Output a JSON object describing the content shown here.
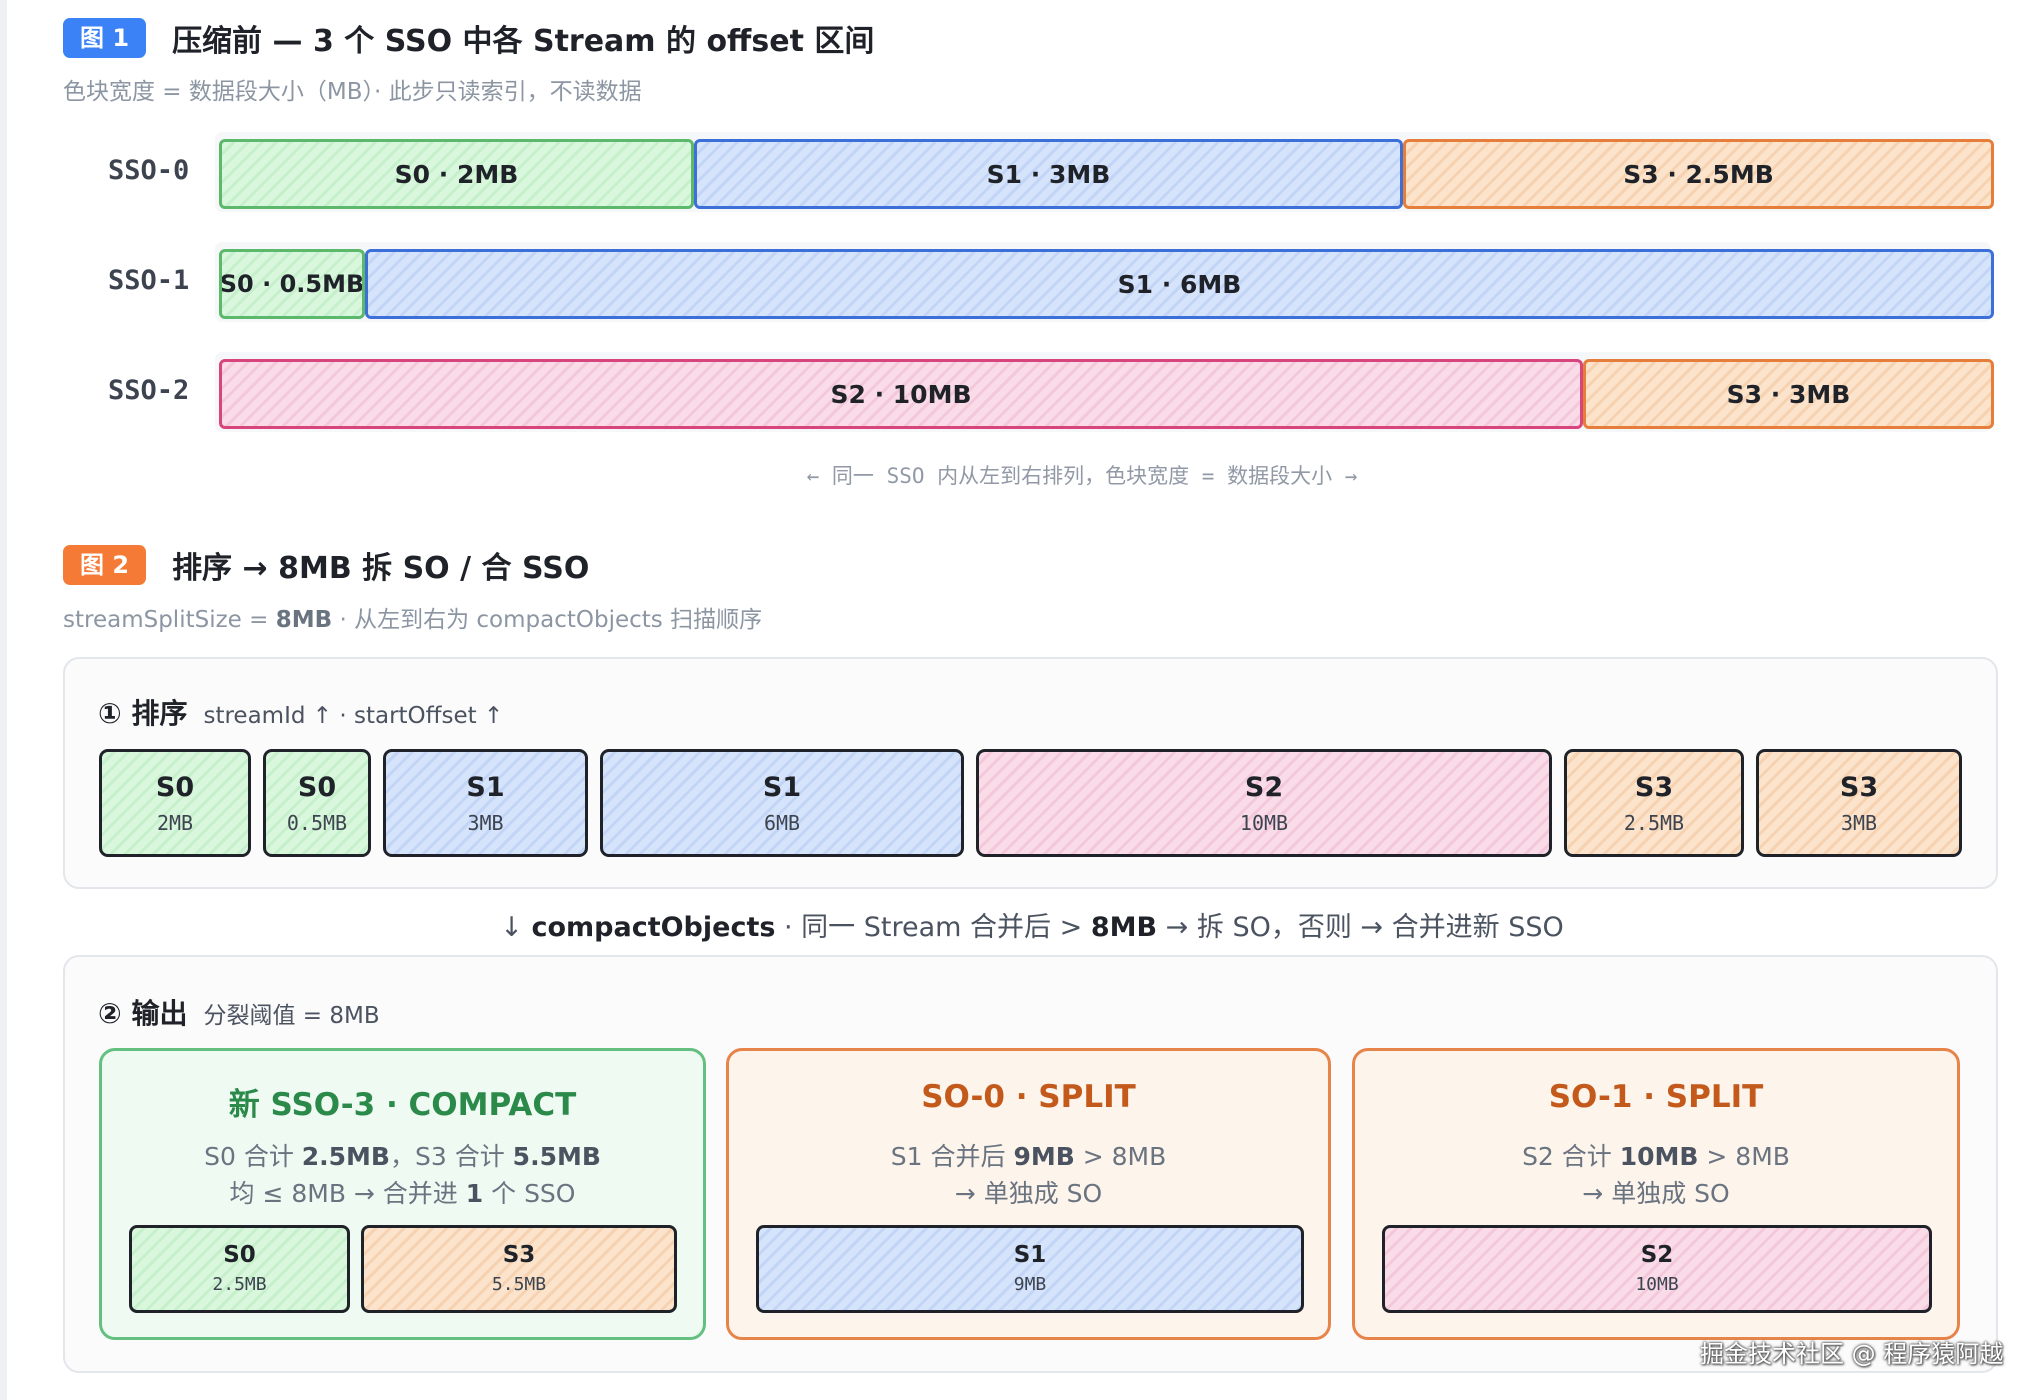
{
  "fig1": {
    "badge": "图 1",
    "title": "压缩前 — 3 个 SSO 中各 Stream 的 offset 区间",
    "subtitle": "色块宽度 = 数据段大小（MB）· 此步只读索引，不读数据",
    "rows": [
      {
        "name": "SSO-0",
        "segments": [
          {
            "label": "S0 · 2MB",
            "stream": "S0",
            "size_mb": 2
          },
          {
            "label": "S1 · 3MB",
            "stream": "S1",
            "size_mb": 3
          },
          {
            "label": "S3 · 2.5MB",
            "stream": "S3",
            "size_mb": 2.5
          }
        ]
      },
      {
        "name": "SSO-1",
        "segments": [
          {
            "label": "S0 · 0.5MB",
            "stream": "S0",
            "size_mb": 0.5
          },
          {
            "label": "S1 · 6MB",
            "stream": "S1",
            "size_mb": 6
          }
        ]
      },
      {
        "name": "SSO-2",
        "segments": [
          {
            "label": "S2 · 10MB",
            "stream": "S2",
            "size_mb": 10
          },
          {
            "label": "S3 · 3MB",
            "stream": "S3",
            "size_mb": 3
          }
        ]
      }
    ],
    "note": "← 同一 SSO 内从左到右排列，色块宽度 = 数据段大小 →"
  },
  "fig2": {
    "badge": "图 2",
    "title": "排序 → 8MB 拆 SO / 合 SSO",
    "subtitle_pre": "streamSplitSize = ",
    "subtitle_bold": "8MB",
    "subtitle_post": " · 从左到右为 compactObjects 扫描顺序",
    "sort_panel": {
      "title": "① 排序",
      "hint": "streamId ↑ · startOffset ↑",
      "cards": [
        {
          "name": "S0",
          "size": "2MB"
        },
        {
          "name": "S0",
          "size": "0.5MB"
        },
        {
          "name": "S1",
          "size": "3MB"
        },
        {
          "name": "S1",
          "size": "6MB"
        },
        {
          "name": "S2",
          "size": "10MB"
        },
        {
          "name": "S3",
          "size": "2.5MB"
        },
        {
          "name": "S3",
          "size": "3MB"
        }
      ]
    },
    "arrow_line": {
      "p1": "↓ ",
      "b1": "compactObjects",
      "p2": " · 同一 Stream 合并后 > ",
      "b2": "8MB",
      "p3": " → 拆 SO，否则 → 合并进新 SSO"
    },
    "output_panel": {
      "title": "② 输出",
      "hint": "分裂阈值 = 8MB",
      "cards": [
        {
          "title": "新 SSO-3 · COMPACT",
          "l1a": "S0 合计 ",
          "l1b": "2.5MB",
          "l1c": "，S3 合计 ",
          "l1d": "5.5MB",
          "l2a": "均 ≤ 8MB → 合并进 ",
          "l2b": "1",
          "l2c": " 个 SSO",
          "items": [
            {
              "name": "S0",
              "size": "2.5MB"
            },
            {
              "name": "S3",
              "size": "5.5MB"
            }
          ]
        },
        {
          "title": "SO-0 · SPLIT",
          "l1a": "S1 合并后 ",
          "l1b": "9MB",
          "l1c": " > 8MB",
          "l2": "→ 单独成 SO",
          "items": [
            {
              "name": "S1",
              "size": "9MB"
            }
          ]
        },
        {
          "title": "SO-1 · SPLIT",
          "l1a": "S2 合计 ",
          "l1b": "10MB",
          "l1c": " > 8MB",
          "l2": "→ 单独成 SO",
          "items": [
            {
              "name": "S2",
              "size": "10MB"
            }
          ]
        }
      ]
    }
  },
  "watermark": "掘金技术社区 @ 程序猿阿越",
  "colors": {
    "S0": "#5cb86a",
    "S1": "#3d6fd9",
    "S2": "#d6457c",
    "S3": "#e47e3a",
    "badge1": "#3b82f6",
    "badge2": "#f47a35"
  }
}
